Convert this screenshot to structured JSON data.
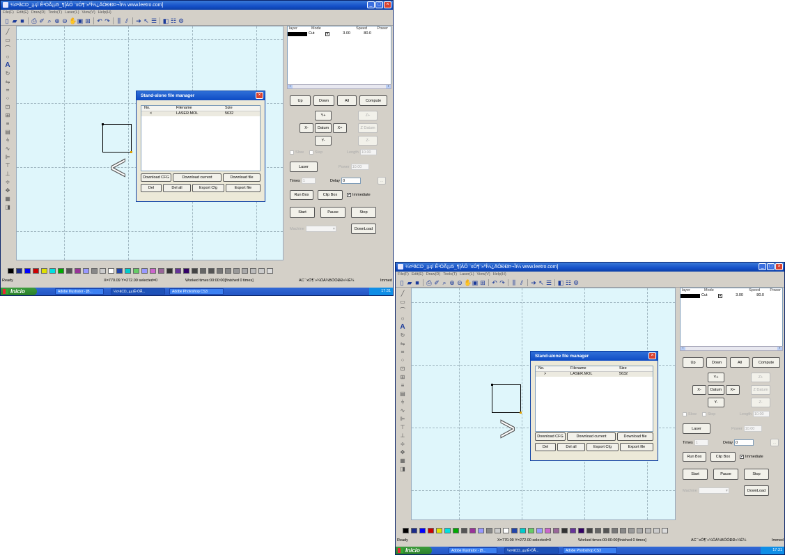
{
  "window": {
    "title": "¼¤¹âCD_¡µ¡ì Ê¹ÓÃ¡µ5_¶[ÀÖ ¨xÓ¶¨»ºÍ¼¿ÄÓÐÐÞ¬Îï¼ www.leetro.com]",
    "minimize_icon": "minimize-icon",
    "maximize_icon": "maximize-icon",
    "close_icon": "close-icon"
  },
  "menu": [
    "File(F)",
    "Edit(E)",
    "Draw(D)",
    "Tools(T)",
    "Laser(L)",
    "View(V)",
    "Help(H)"
  ],
  "toolbar_icons": [
    "new-file-icon",
    "open-file-icon",
    "save-icon",
    "print-icon",
    "pen-icon",
    "zoom-window-icon",
    "zoom-in-icon",
    "zoom-out-icon",
    "pan-icon",
    "select-all-icon",
    "fit-icon",
    "undo-icon",
    "redo-icon",
    "align-icon",
    "distribute-icon",
    "laser-path-icon",
    "pointer-icon",
    "list-icon",
    "preview-icon",
    "settings-icon",
    "gear-icon"
  ],
  "left_tools": [
    "line-tool-icon",
    "rectangle-tool-icon",
    "polyline-tool-icon",
    "ellipse-tool-icon",
    "text-tool-icon",
    "rotate-tool-icon",
    "mirror-tool-icon",
    "node-tool-icon",
    "dots-tool-icon",
    "array-tool-icon",
    "grid-tool-icon",
    "fill-tool-icon",
    "hatch-tool-icon",
    "cut-tool-icon",
    "wave-tool-icon",
    "align-left-icon",
    "align-top-icon",
    "align-center-icon",
    "distribute-tool-icon",
    "move-tool-icon",
    "table-tool-icon",
    "layers-tool-icon"
  ],
  "dialog": {
    "title": "Stand-alone file manager",
    "columns": [
      "No.",
      "Filename",
      "Size"
    ],
    "row": {
      "filename": "LASER.MOL",
      "size": "5632"
    },
    "row_marker_1": "<",
    "row_marker_2": ">",
    "buttons_row1": [
      "Download CFG",
      "Download current",
      "Download file"
    ],
    "buttons_row2": [
      "Del",
      "Del all",
      "Export Cfg",
      "Export file"
    ]
  },
  "layer_table": {
    "columns": [
      "layer",
      "Mode",
      "Speed",
      "Power"
    ],
    "row": {
      "mode": "Cut",
      "speed": "3.00",
      "power": "80.0"
    }
  },
  "control_panel": {
    "up": "Up",
    "down": "Down",
    "all": "All",
    "compute": "Compute",
    "y_plus": "Y+",
    "y_minus": "Y-",
    "x_minus": "X-",
    "x_plus": "X+",
    "datum": "Datum",
    "z_plus": "Z+",
    "z_minus": "Z-",
    "z_datum": "Z Datum",
    "slow": "Slow",
    "step": "Step",
    "length_label": "Length",
    "length_value": "10.00",
    "laser": "Laser",
    "power_label": "Power",
    "power_value": "10.00",
    "times_label": "Times",
    "times_value": "1",
    "delay_label": "Delay",
    "delay_value": "0",
    "more": "...",
    "run_box": "Run Box",
    "clip_box": "Clip Box",
    "immediate": "Immediate",
    "start": "Start",
    "pause": "Pause",
    "stop": "Stop",
    "machine_label": "Machine",
    "download": "DownLoad"
  },
  "palette": [
    "#000000",
    "#1a2a8a",
    "#0000ff",
    "#cc0000",
    "#e0e000",
    "#00e0e0",
    "#00aa00",
    "#555555",
    "#993399",
    "#9999ff",
    "#888888",
    "#cccccc",
    "#ffffff",
    "#2244aa",
    "#00cccc",
    "#66cc66",
    "#9999ff",
    "#cc66cc",
    "#996699",
    "#333333",
    "#663399",
    "#330066",
    "#444444",
    "#666666",
    "#555555",
    "#777777",
    "#888888",
    "#999999",
    "#aaaaaa",
    "#bbbbbb",
    "#cccccc",
    "#dddddd"
  ],
  "status": {
    "ready": "Ready",
    "coords": "X=770.09 Y=272.00 selected=0",
    "worked": "Worked times:00:00:00[finished 0 times]",
    "encoded": "AC¨¨xÓ¶¨»¼ÓÁ¼BÓÓÐÐ»¼Ë¼",
    "immediate": "Immed"
  },
  "taskbar": {
    "start": "Inicio",
    "tasks": [
      "Adobe Illustrator - [B...",
      "¼¤¹âCD_¡µ¡ìÊ¹ÓÃ...",
      "Adobe Photoshop CS3"
    ],
    "clock": "17:31"
  }
}
